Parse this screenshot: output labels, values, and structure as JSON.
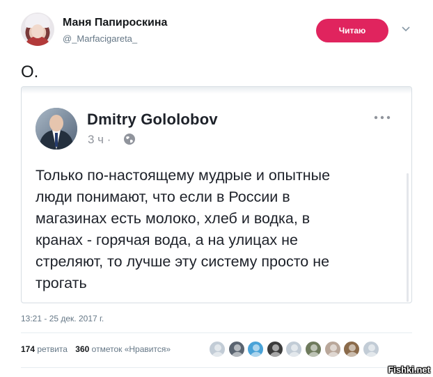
{
  "tweet": {
    "author_name": "Маня Папироскина",
    "author_handle": "@_Marfacigareta_",
    "follow_label": "Читаю",
    "text": "О.",
    "timestamp": "13:21 - 25 дек. 2017 г.",
    "retweets_count": "174",
    "retweets_label": "ретвита",
    "likes_count": "360",
    "likes_label": "отметок «Нравится»",
    "liker_avatars": [
      "avatar-1",
      "avatar-2",
      "avatar-3",
      "avatar-4",
      "avatar-5",
      "avatar-6",
      "avatar-7",
      "avatar-8",
      "avatar-9"
    ]
  },
  "quoted_post": {
    "author_name": "Dmitry Gololobov",
    "time": "3 ч ·",
    "lines": [
      "Только по-настоящему мудрые и опытные",
      "люди понимают, что если в России в",
      "магазинах есть молоко, хлеб и водка, в",
      "кранах - горячая вода, а на улицах не",
      "стреляют, то лучше эту систему просто не",
      "трогать"
    ]
  },
  "watermark": "Fishki.net",
  "colors": {
    "follow_button": "#e0245e",
    "muted_text": "#657786",
    "fb_muted": "#90949c"
  }
}
